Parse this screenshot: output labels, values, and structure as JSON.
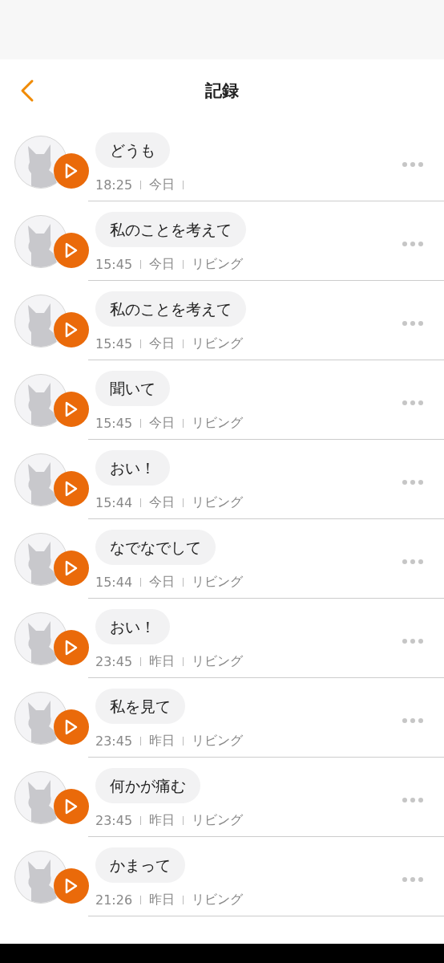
{
  "header": {
    "title": "記録"
  },
  "records": [
    {
      "message": "どうも",
      "time": "18:25",
      "day": "今日"
    },
    {
      "message": "私のことを考えて",
      "time": "15:45",
      "day": "今日",
      "place": "リビング"
    },
    {
      "message": "私のことを考えて",
      "time": "15:45",
      "day": "今日",
      "place": "リビング"
    },
    {
      "message": "聞いて",
      "time": "15:45",
      "day": "今日",
      "place": "リビング"
    },
    {
      "message": "おい！",
      "time": "15:44",
      "day": "今日",
      "place": "リビング"
    },
    {
      "message": "なでなでして",
      "time": "15:44",
      "day": "今日",
      "place": "リビング"
    },
    {
      "message": "おい！",
      "time": "23:45",
      "day": "昨日",
      "place": "リビング"
    },
    {
      "message": "私を見て",
      "time": "23:45",
      "day": "昨日",
      "place": "リビング"
    },
    {
      "message": "何かが痛む",
      "time": "23:45",
      "day": "昨日",
      "place": "リビング"
    },
    {
      "message": "かまって",
      "time": "21:26",
      "day": "昨日",
      "place": "リビング"
    }
  ]
}
